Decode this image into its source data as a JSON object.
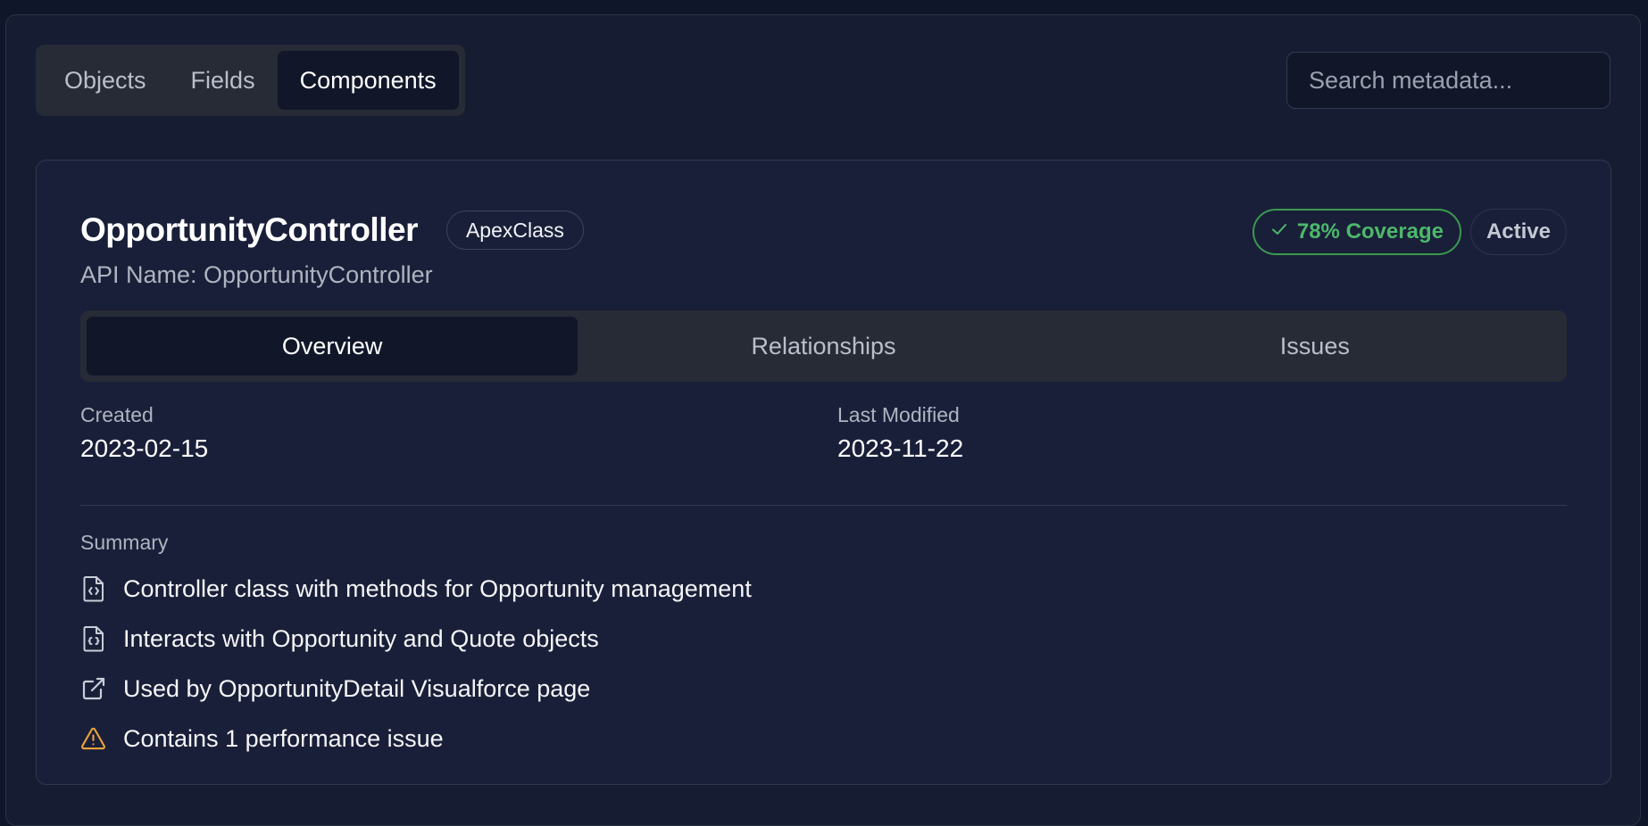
{
  "top_tabs": [
    {
      "label": "Objects",
      "active": false
    },
    {
      "label": "Fields",
      "active": false
    },
    {
      "label": "Components",
      "active": true
    }
  ],
  "search": {
    "placeholder": "Search metadata..."
  },
  "component": {
    "name": "OpportunityController",
    "type": "ApexClass",
    "coverage": "78% Coverage",
    "coverage_color": "#4cb86a",
    "status": "Active",
    "api_name": "API Name: OpportunityController"
  },
  "detail_tabs": [
    {
      "label": "Overview",
      "active": true
    },
    {
      "label": "Relationships",
      "active": false
    },
    {
      "label": "Issues",
      "active": false
    }
  ],
  "meta": {
    "created_label": "Created",
    "created_value": "2023-02-15",
    "modified_label": "Last Modified",
    "modified_value": "2023-11-22"
  },
  "summary": {
    "label": "Summary",
    "items": [
      {
        "icon": "file-code-icon",
        "text": "Controller class with methods for Opportunity management"
      },
      {
        "icon": "file-code-icon",
        "text": "Interacts with Opportunity and Quote objects"
      },
      {
        "icon": "external-link-icon",
        "text": "Used by OpportunityDetail Visualforce page"
      },
      {
        "icon": "warning-icon",
        "text": "Contains 1 performance issue",
        "color": "#e8a23a"
      }
    ]
  }
}
